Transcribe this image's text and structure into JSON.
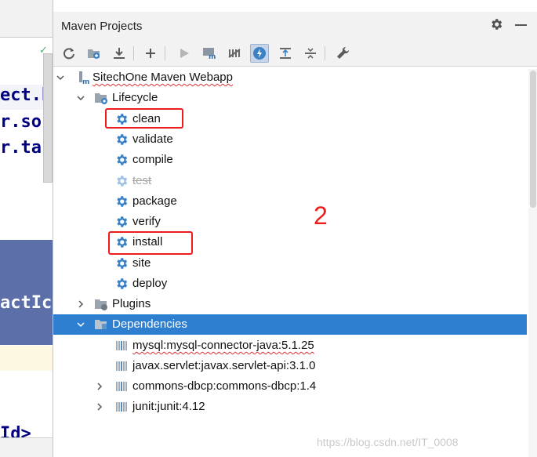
{
  "editor": {
    "lines": [
      "ect.b",
      "r.so",
      "r.ta"
    ],
    "selected_line": "actIc",
    "bottom_line": "Id>"
  },
  "panel": {
    "title": "Maven Projects"
  },
  "tree": {
    "project": "SitechOne Maven Webapp",
    "lifecycle": {
      "label": "Lifecycle",
      "phases": [
        "clean",
        "validate",
        "compile",
        "test",
        "package",
        "verify",
        "install",
        "site",
        "deploy"
      ]
    },
    "plugins": "Plugins",
    "dependencies": {
      "label": "Dependencies",
      "items": [
        "mysql:mysql-connector-java:5.1.25",
        "javax.servlet:javax.servlet-api:3.1.0",
        "commons-dbcp:commons-dbcp:1.4",
        "junit:junit:4.12"
      ]
    }
  },
  "annotation": "2",
  "watermark": "https://blog.csdn.net/IT_0008",
  "colors": {
    "selection": "#2f7fd0",
    "highlight_box": "#ee1c1c",
    "gear": "#3b82c4"
  }
}
